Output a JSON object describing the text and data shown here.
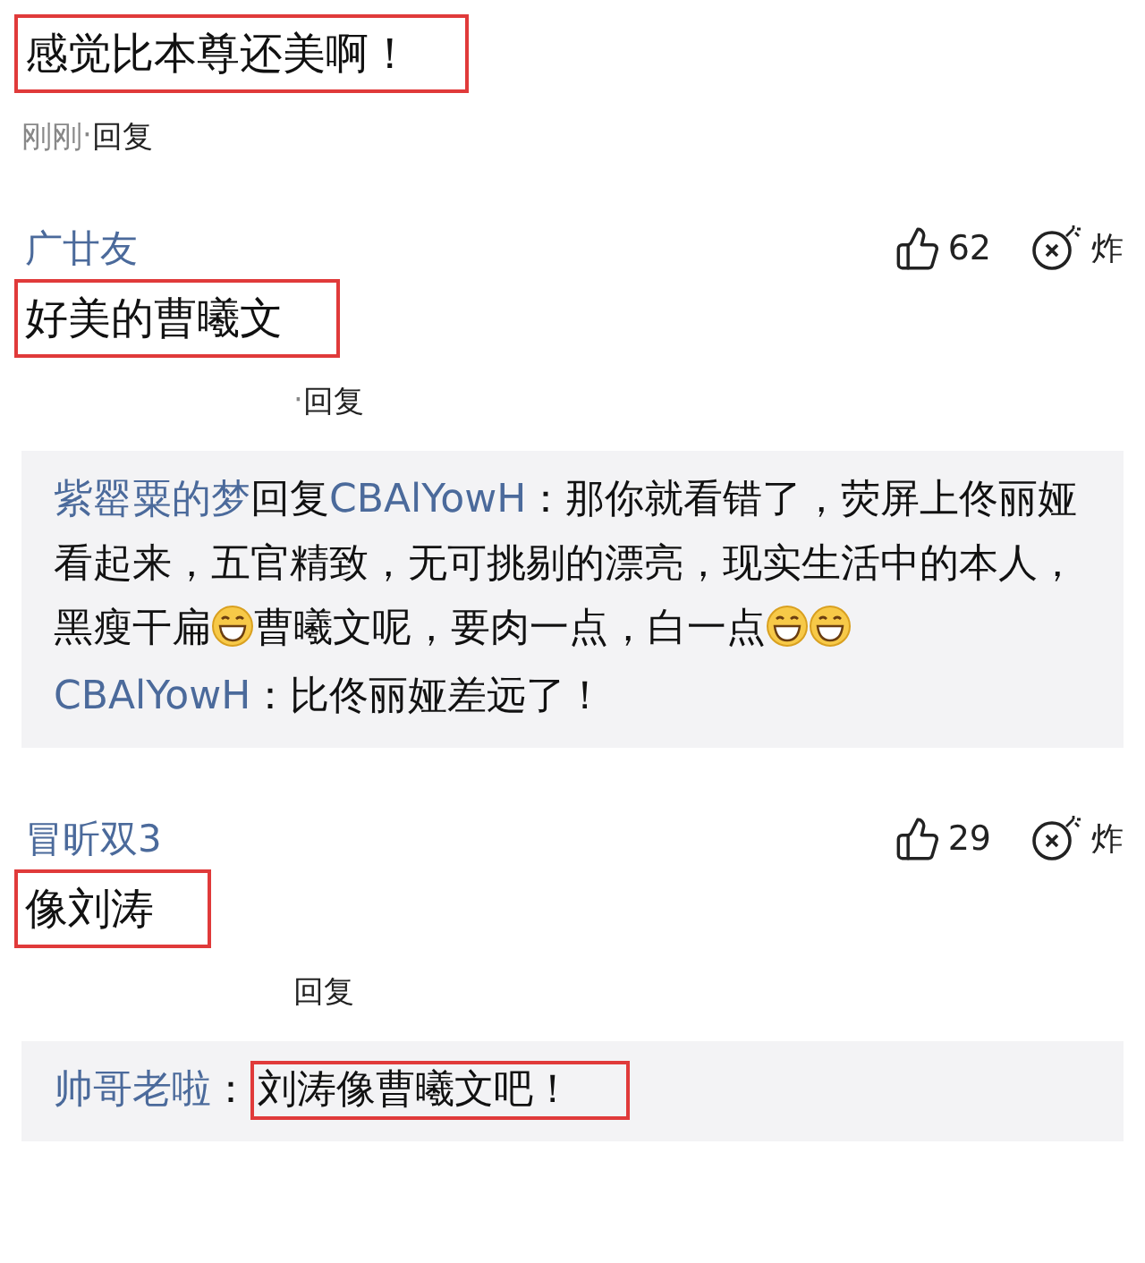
{
  "comments": [
    {
      "text": "感觉比本尊还美啊！",
      "highlighted": true,
      "time": "刚刚",
      "separator": "·",
      "reply_label": "回复"
    },
    {
      "user": "广廿友",
      "likes": "62",
      "bomb_label": "炸",
      "text": "好美的曹曦文",
      "highlighted": true,
      "separator": "·",
      "reply_label": "回复",
      "replies": [
        {
          "segments": [
            {
              "kind": "user",
              "text": "紫罂粟的梦"
            },
            {
              "kind": "text",
              "text": "回复"
            },
            {
              "kind": "user",
              "text": "CBAlYowH"
            },
            {
              "kind": "text",
              "text": "：那你就看错了，荧屏上佟丽娅看起来，五官精致，无可挑剔的漂亮，现实生活中的本人，黑瘦干扁"
            },
            {
              "kind": "emoji"
            },
            {
              "kind": "text",
              "text": "曹曦文呢，要肉一点，白一点"
            },
            {
              "kind": "emoji"
            },
            {
              "kind": "emoji"
            }
          ]
        },
        {
          "segments": [
            {
              "kind": "user",
              "text": "CBAlYowH"
            },
            {
              "kind": "text",
              "text": "：比佟丽娅差远了！"
            }
          ]
        }
      ]
    },
    {
      "user": "冒昕双3",
      "likes": "29",
      "bomb_label": "炸",
      "text": "像刘涛",
      "highlighted": true,
      "reply_label": "回复",
      "replies": [
        {
          "segments": [
            {
              "kind": "user",
              "text": "帅哥老啦"
            },
            {
              "kind": "text",
              "text": "："
            },
            {
              "kind": "highlight",
              "text": "刘涛像曹曦文吧！"
            }
          ]
        }
      ]
    }
  ]
}
